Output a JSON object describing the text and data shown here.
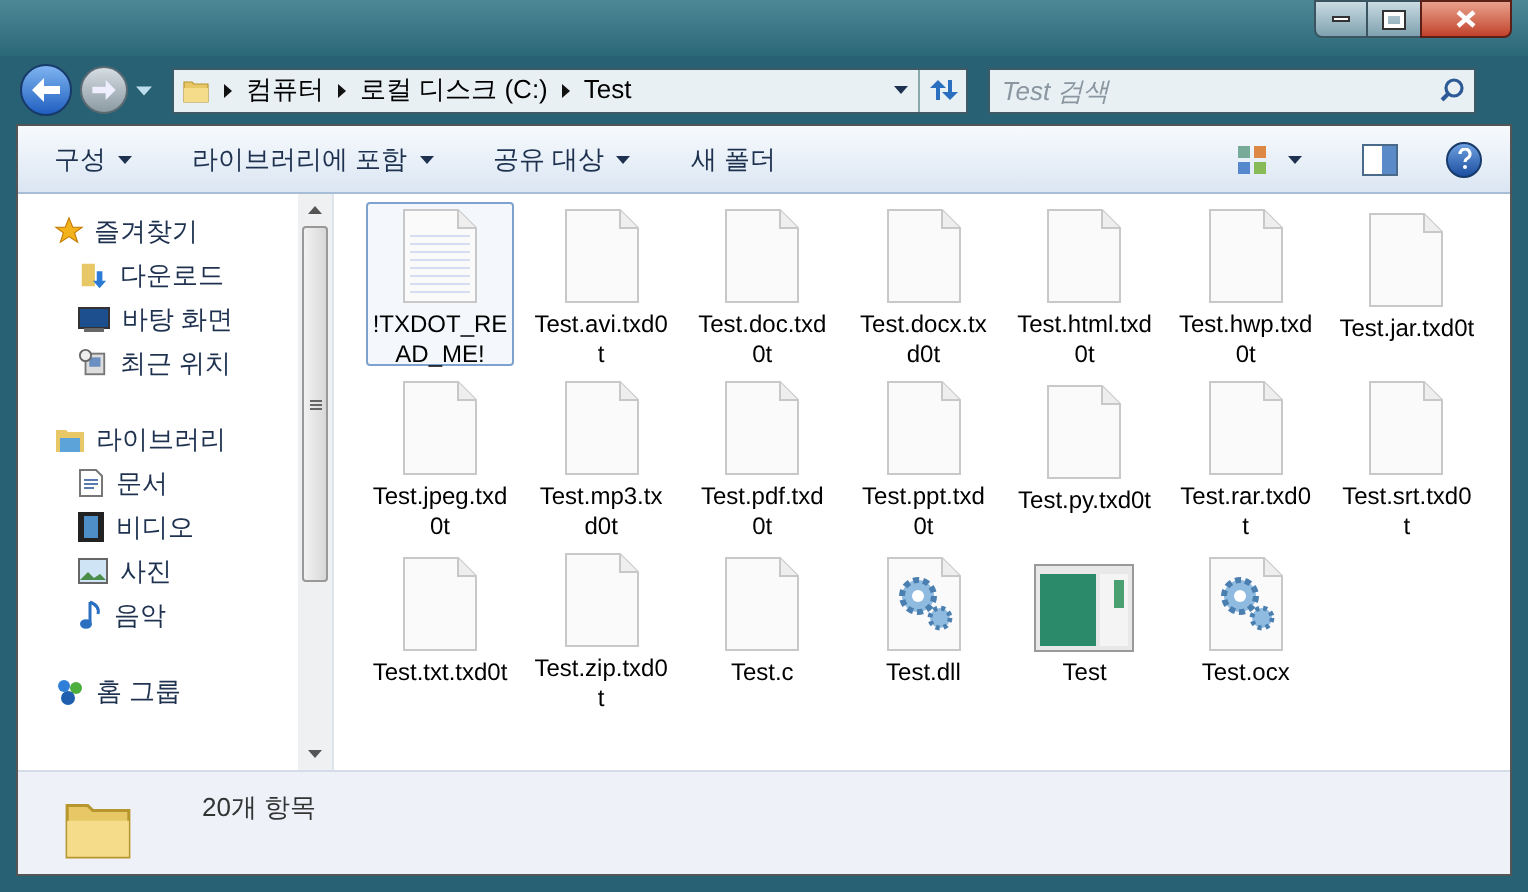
{
  "address_bar": {
    "segments": [
      "컴퓨터",
      "로컬 디스크 (C:)",
      "Test"
    ]
  },
  "search": {
    "placeholder": "Test 검색"
  },
  "toolbar": {
    "menus": [
      {
        "label": "구성",
        "dropdown": true
      },
      {
        "label": "라이브러리에 포함",
        "dropdown": true
      },
      {
        "label": "공유 대상",
        "dropdown": true
      },
      {
        "label": "새 폴더",
        "dropdown": false
      }
    ]
  },
  "sidebar": {
    "groups": [
      {
        "label": "즐겨찾기",
        "kind": "favorites",
        "children": [
          {
            "label": "다운로드",
            "kind": "downloads"
          },
          {
            "label": "바탕 화면",
            "kind": "desktop"
          },
          {
            "label": "최근 위치",
            "kind": "recent"
          }
        ]
      },
      {
        "label": "라이브러리",
        "kind": "libraries",
        "children": [
          {
            "label": "문서",
            "kind": "documents"
          },
          {
            "label": "비디오",
            "kind": "videos"
          },
          {
            "label": "사진",
            "kind": "pictures"
          },
          {
            "label": "음악",
            "kind": "music"
          }
        ]
      },
      {
        "label": "홈 그룹",
        "kind": "homegroup"
      }
    ]
  },
  "files": [
    {
      "name": "!TXDOT_READ_ME!",
      "kind": "text",
      "selected": true
    },
    {
      "name": "Test.avi.txd0t",
      "kind": "blank",
      "selected": false
    },
    {
      "name": "Test.doc.txd0t",
      "kind": "blank",
      "selected": false
    },
    {
      "name": "Test.docx.txd0t",
      "kind": "blank",
      "selected": false
    },
    {
      "name": "Test.html.txd0t",
      "kind": "blank",
      "selected": false
    },
    {
      "name": "Test.hwp.txd0t",
      "kind": "blank",
      "selected": false
    },
    {
      "name": "Test.jar.txd0t",
      "kind": "blank",
      "selected": false
    },
    {
      "name": "Test.jpeg.txd0t",
      "kind": "blank",
      "selected": false
    },
    {
      "name": "Test.mp3.txd0t",
      "kind": "blank",
      "selected": false
    },
    {
      "name": "Test.pdf.txd0t",
      "kind": "blank",
      "selected": false
    },
    {
      "name": "Test.ppt.txd0t",
      "kind": "blank",
      "selected": false
    },
    {
      "name": "Test.py.txd0t",
      "kind": "blank",
      "selected": false
    },
    {
      "name": "Test.rar.txd0t",
      "kind": "blank",
      "selected": false
    },
    {
      "name": "Test.srt.txd0t",
      "kind": "blank",
      "selected": false
    },
    {
      "name": "Test.txt.txd0t",
      "kind": "blank",
      "selected": false
    },
    {
      "name": "Test.zip.txd0t",
      "kind": "blank",
      "selected": false
    },
    {
      "name": "Test.c",
      "kind": "blank",
      "selected": false
    },
    {
      "name": "Test.dll",
      "kind": "gear",
      "selected": false
    },
    {
      "name": "Test",
      "kind": "app",
      "selected": false
    },
    {
      "name": "Test.ocx",
      "kind": "gear",
      "selected": false
    }
  ],
  "status_bar": {
    "item_count": "20개 항목"
  }
}
